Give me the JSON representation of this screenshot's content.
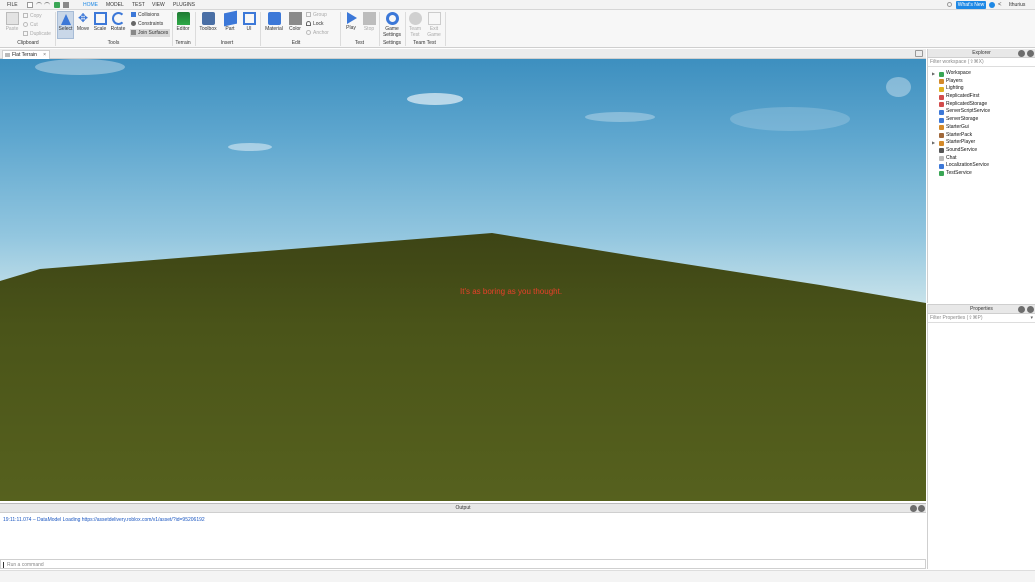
{
  "menubar": {
    "items": [
      "FILE",
      "HOME",
      "MODEL",
      "TEST",
      "VIEW",
      "PLUGINS"
    ],
    "active": "HOME",
    "whats_new": "What's New",
    "username": "Ithurius"
  },
  "ribbon": {
    "clipboard": {
      "paste": "Paste",
      "copy": "Copy",
      "cut": "Cut",
      "duplicate": "Duplicate",
      "group_label": "Clipboard"
    },
    "tools": {
      "select": "Select",
      "move": "Move",
      "scale": "Scale",
      "rotate": "Rotate",
      "collisions": "Collisions",
      "constraints": "Constraints",
      "join_surfaces": "Join Surfaces",
      "group_label": "Tools"
    },
    "terrain": {
      "editor": "Editor",
      "group_label": "Terrain"
    },
    "insert": {
      "toolbox": "Toolbox",
      "part": "Part",
      "ui": "UI",
      "group_label": "Insert"
    },
    "edit": {
      "material": "Material",
      "color": "Color",
      "group": "Group",
      "lock": "Lock",
      "anchor": "Anchor",
      "group_label": "Edit"
    },
    "test": {
      "play": "Play",
      "stop": "Stop",
      "group_label": "Test"
    },
    "settings": {
      "game_settings_line1": "Game",
      "game_settings_line2": "Settings",
      "group_label": "Settings"
    },
    "team_test": {
      "team_test_line1": "Team",
      "team_test_line2": "Test",
      "exit_game_line1": "Exit",
      "exit_game_line2": "Game",
      "group_label": "Team Test"
    }
  },
  "document_tab": {
    "title": "Flat Terrain"
  },
  "viewport": {
    "center_text": "It's as boring as you thought."
  },
  "explorer": {
    "title": "Explorer",
    "filter_placeholder": "Filter workspace (⇧⌘X)",
    "items": [
      {
        "label": "Workspace",
        "expandable": true,
        "icon": "globe-icon",
        "color": "#3aa655"
      },
      {
        "label": "Players",
        "expandable": false,
        "icon": "players-icon",
        "color": "#d48a2a"
      },
      {
        "label": "Lighting",
        "expandable": false,
        "icon": "lighting-icon",
        "color": "#e0b21f"
      },
      {
        "label": "ReplicatedFirst",
        "expandable": false,
        "icon": "replicated-first-icon",
        "color": "#d24c4c"
      },
      {
        "label": "ReplicatedStorage",
        "expandable": false,
        "icon": "replicated-storage-icon",
        "color": "#d24c4c"
      },
      {
        "label": "ServerScriptService",
        "expandable": false,
        "icon": "server-script-icon",
        "color": "#3c78d8"
      },
      {
        "label": "ServerStorage",
        "expandable": false,
        "icon": "server-storage-icon",
        "color": "#3c78d8"
      },
      {
        "label": "StarterGui",
        "expandable": false,
        "icon": "starter-gui-icon",
        "color": "#d48a2a"
      },
      {
        "label": "StarterPack",
        "expandable": false,
        "icon": "starter-pack-icon",
        "color": "#a0683a"
      },
      {
        "label": "StarterPlayer",
        "expandable": true,
        "icon": "starter-player-icon",
        "color": "#d48a2a"
      },
      {
        "label": "SoundService",
        "expandable": false,
        "icon": "sound-icon",
        "color": "#555555"
      },
      {
        "label": "Chat",
        "expandable": false,
        "icon": "chat-icon",
        "color": "#bbbbbb"
      },
      {
        "label": "LocalizationService",
        "expandable": false,
        "icon": "localization-icon",
        "color": "#3c78d8"
      },
      {
        "label": "TestService",
        "expandable": false,
        "icon": "test-icon",
        "color": "#3aa655"
      }
    ]
  },
  "properties": {
    "title": "Properties",
    "filter_placeholder": "Filter Properties (⇧⌘P)"
  },
  "output": {
    "title": "Output",
    "lines": [
      "19:11:11.074 – DataModel Loading https://assetdelivery.roblox.com/v1/asset/?id=95206192"
    ]
  },
  "command_bar": {
    "placeholder": "Run a command"
  },
  "colors": {
    "accent": "#1e88e5",
    "center_text": "#e8402a",
    "log_text": "#1a56c0",
    "ground": "#4a5419"
  }
}
